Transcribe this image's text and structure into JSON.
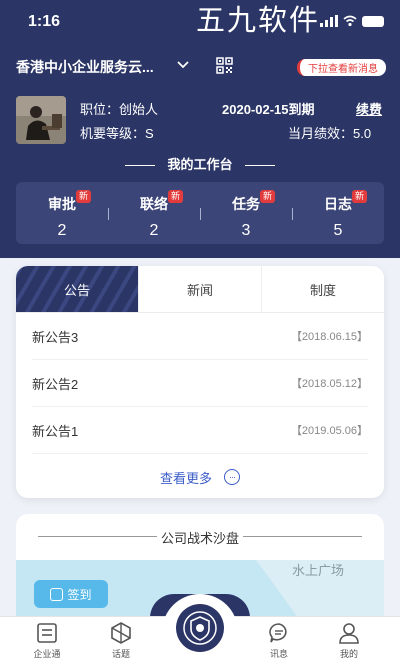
{
  "status": {
    "time": "1:16",
    "watermark": "五九软件"
  },
  "company": {
    "name": "香港中小企业服务云...",
    "pull_notice": "下拉查看新消息"
  },
  "profile": {
    "position": "职位：创始人",
    "level": "机要等级：S",
    "expire": "2020-02-15到期",
    "renew": "续费",
    "performance": "当月绩效：5.0"
  },
  "workbench": {
    "title": "我的工作台"
  },
  "stats": [
    {
      "label": "审批",
      "value": "2",
      "badge": "新"
    },
    {
      "label": "联络",
      "value": "2",
      "badge": "新"
    },
    {
      "label": "任务",
      "value": "3",
      "badge": "新"
    },
    {
      "label": "日志",
      "value": "5",
      "badge": "新"
    }
  ],
  "tabs": [
    {
      "label": "公告",
      "active": true
    },
    {
      "label": "新闻",
      "active": false
    },
    {
      "label": "制度",
      "active": false
    }
  ],
  "notices": [
    {
      "title": "新公告3",
      "date": "【2018.06.15】"
    },
    {
      "title": "新公告2",
      "date": "【2018.05.12】"
    },
    {
      "title": "新公告1",
      "date": "【2019.05.06】"
    }
  ],
  "see_more": "查看更多",
  "strategy": {
    "title": "公司战术沙盘",
    "map_label": "水上广场",
    "signin": "签到"
  },
  "nav": [
    {
      "label": "企业通",
      "icon": "company-icon"
    },
    {
      "label": "话题",
      "icon": "topic-icon"
    },
    {
      "label": "讯息",
      "icon": "message-icon"
    },
    {
      "label": "我的",
      "icon": "profile-icon"
    }
  ],
  "colors": {
    "header": "#2b3566",
    "badge": "#e23b3b",
    "link": "#3a5cc8",
    "map": "#bfe4f2",
    "signin": "#57b9ea"
  }
}
